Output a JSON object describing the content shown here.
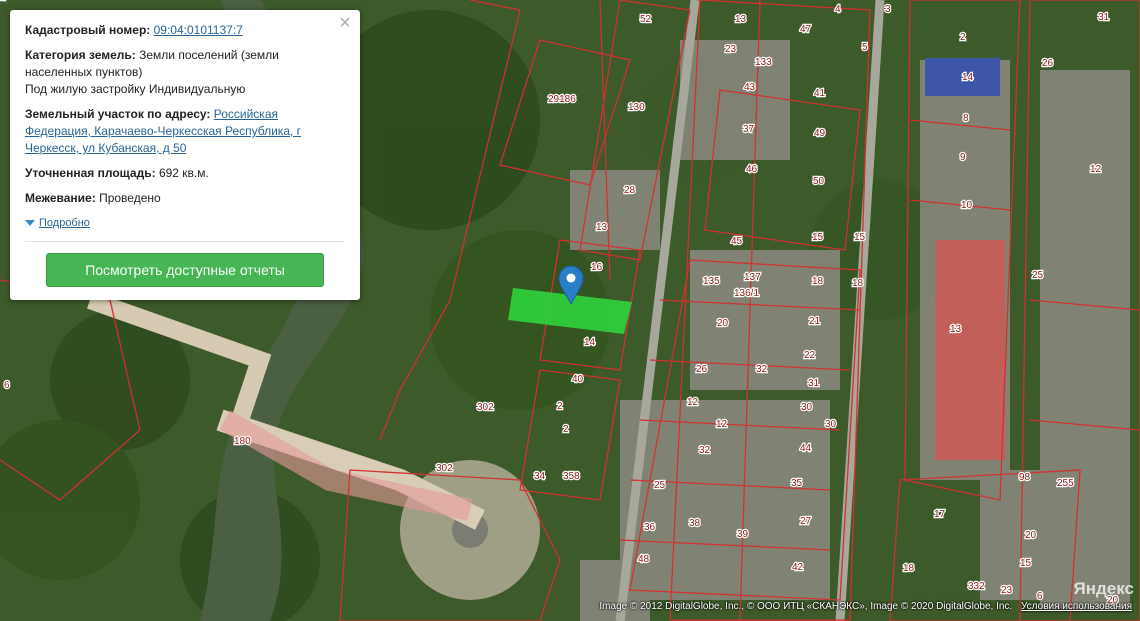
{
  "panel": {
    "cadastral_label": "Кадастровый номер:",
    "cadastral_number": "09:04:0101137:7",
    "category_label": "Категория земель:",
    "category_value": "Земли поселений (земли населенных пунктов)",
    "usage_value": "Под жилую застройку Индивидуальную",
    "address_label": "Земельный участок по адресу:",
    "address_value": "Российская Федерация, Карачаево-Черкесская Республика, г Черкесск, ул Кубанская, д 50",
    "area_label": "Уточненная площадь:",
    "area_value": "692 кв.м.",
    "survey_label": "Межевание:",
    "survey_value": "Проведено",
    "details_label": "Подробно",
    "reports_button": "Посмотреть доступные отчеты",
    "close_icon": "close-icon"
  },
  "map": {
    "parcel_labels": [
      "52",
      "13",
      "23",
      "47",
      "4",
      "3",
      "31",
      "133",
      "5",
      "2",
      "26",
      "130",
      "29186",
      "43",
      "41",
      "14",
      "37",
      "49",
      "8",
      "46",
      "50",
      "9",
      "12",
      "28",
      "10",
      "13",
      "45",
      "15",
      "15",
      "16",
      "137",
      "136/1",
      "18",
      "135",
      "18",
      "25",
      "21",
      "20",
      "13",
      "14",
      "22",
      "26",
      "32",
      "31",
      "40",
      "302",
      "12",
      "30",
      "30",
      "2",
      "12",
      "44",
      "2",
      "32",
      "180",
      "302",
      "34",
      "358",
      "25",
      "35",
      "98",
      "255",
      "36",
      "38",
      "39",
      "27",
      "17",
      "20",
      "48",
      "42",
      "18",
      "15",
      "6",
      "332",
      "23",
      "20",
      "6",
      "4",
      "1"
    ],
    "colors": {
      "parcel_outline": "#d0322f",
      "highlight_fill": "#2fd13c",
      "pin": "#2a7ec7"
    }
  },
  "footer": {
    "copyright": "Image © 2012 DigitalGlobe, Inc., © ООО ИТЦ «СКАНЭКС», Image © 2020 DigitalGlobe, Inc.",
    "terms": "Условия использования",
    "logo": "Яндекс"
  }
}
